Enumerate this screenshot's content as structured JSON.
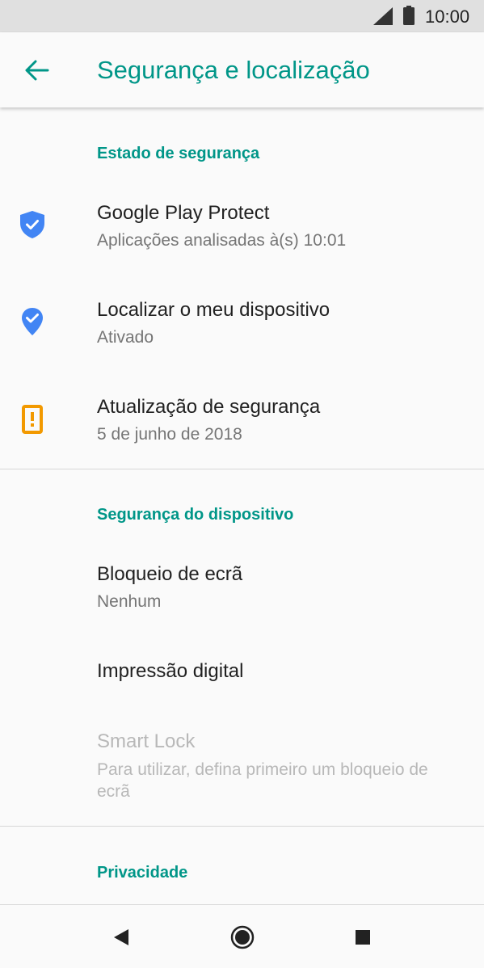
{
  "status_bar": {
    "time": "10:00",
    "signal_icon": "signal-icon",
    "battery_icon": "battery-icon"
  },
  "app_bar": {
    "title": "Segurança e localização",
    "back_icon": "arrow-back-icon",
    "accent_color": "#009688"
  },
  "sections": {
    "security_status": {
      "header": "Estado de segurança",
      "items": [
        {
          "title": "Google Play Protect",
          "subtitle": "Aplicações analisadas à(s) 10:01",
          "icon": "shield-check-icon",
          "icon_color": "#4285f4"
        },
        {
          "title": "Localizar o meu dispositivo",
          "subtitle": "Ativado",
          "icon": "location-check-icon",
          "icon_color": "#4285f4"
        },
        {
          "title": "Atualização de segurança",
          "subtitle": "5 de junho de 2018",
          "icon": "warning-icon",
          "icon_color": "#f29900"
        }
      ]
    },
    "device_security": {
      "header": "Segurança do dispositivo",
      "items": [
        {
          "title": "Bloqueio de ecrã",
          "subtitle": "Nenhum"
        },
        {
          "title": "Impressão digital"
        },
        {
          "title": "Smart Lock",
          "subtitle": "Para utilizar, defina primeiro um bloqueio de ecrã",
          "disabled": true
        }
      ]
    },
    "privacy": {
      "header": "Privacidade"
    }
  },
  "nav_bar": {
    "back_icon": "nav-back-icon",
    "home_icon": "nav-home-icon",
    "recents_icon": "nav-recents-icon"
  }
}
